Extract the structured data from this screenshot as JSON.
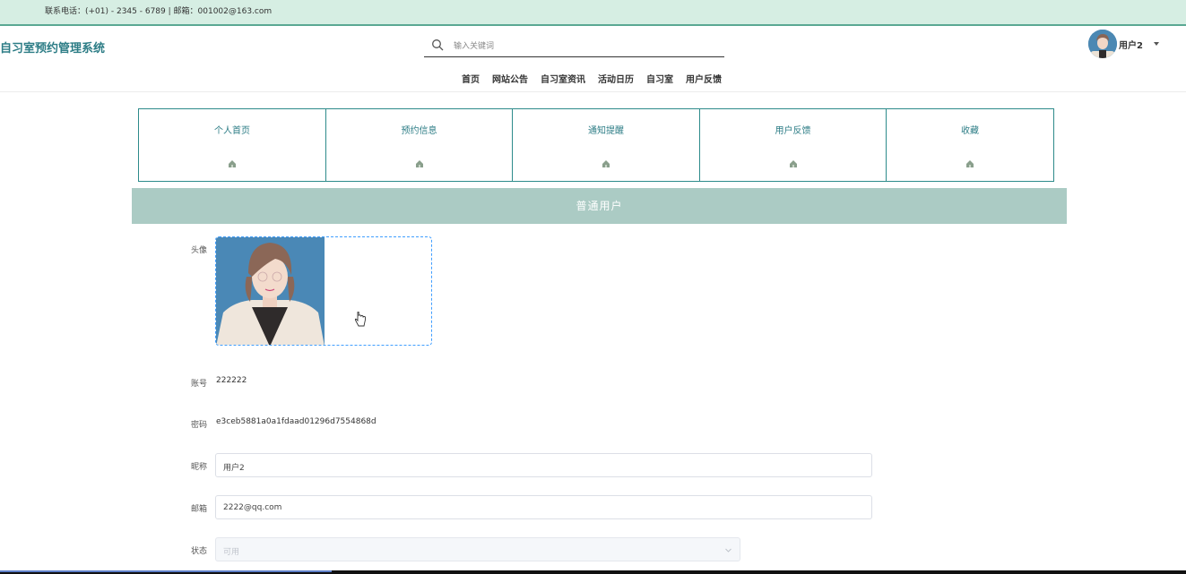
{
  "topbar": {
    "contact": "联系电话：(+01) - 2345 - 6789  |  邮箱：001002@163.com"
  },
  "header": {
    "site_title": "自习室预约管理系统",
    "search_placeholder": "输入关键词",
    "user_name": "用户2"
  },
  "nav": [
    "首页",
    "网站公告",
    "自习室资讯",
    "活动日历",
    "自习室",
    "用户反馈"
  ],
  "tiles": [
    {
      "label": "个人首页",
      "icon": "home-icon"
    },
    {
      "label": "预约信息",
      "icon": "calendar-icon"
    },
    {
      "label": "通知提醒",
      "icon": "bell-icon"
    },
    {
      "label": "用户反馈",
      "icon": "feedback-icon"
    },
    {
      "label": "收藏",
      "icon": "star-icon"
    }
  ],
  "band_title": "普通用户",
  "form": {
    "avatar_label": "头像",
    "account_label": "账号",
    "account_value": "222222",
    "password_label": "密码",
    "password_value": "e3ceb5881a0a1fdaad01296d7554868d",
    "nickname_label": "昵称",
    "nickname_value": "用户2",
    "email_label": "邮箱",
    "email_value": "2222@qq.com",
    "status_label": "状态",
    "status_value": "可用"
  },
  "colors": {
    "accent": "#2d7d86",
    "band": "#abcbc4",
    "topbar": "#d6eee3"
  }
}
